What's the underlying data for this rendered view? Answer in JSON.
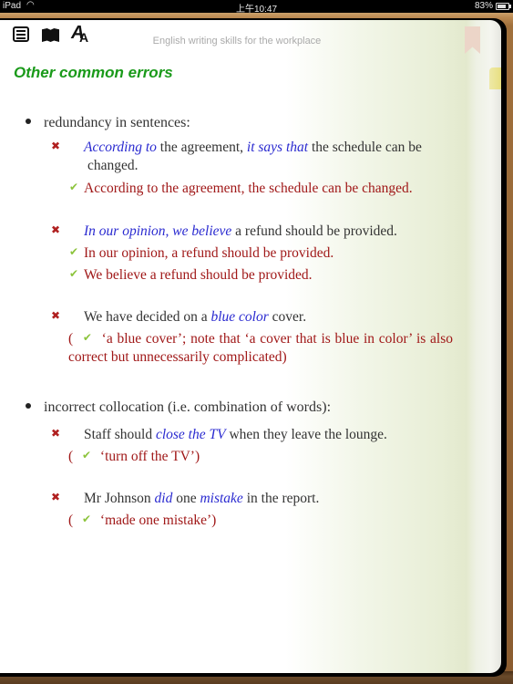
{
  "status_bar": {
    "device": "iPad",
    "wifi_icon": "wifi-icon",
    "time": "上午10:47",
    "battery_percent": "83%",
    "battery_icon": "battery-icon"
  },
  "toolbar": {
    "icons": [
      "table-of-contents-icon",
      "bookmarks-icon",
      "font-size-icon"
    ],
    "font_icon_big": "A",
    "font_icon_small": "A",
    "book_title": "English writing skills for the workplace"
  },
  "page": {
    "section_title": "Other common errors",
    "sections": [
      {
        "heading": "redundancy in sentences:",
        "examples": [
          {
            "wrong": {
              "parts": [
                {
                  "t": "According to",
                  "hl": true
                },
                {
                  "t": " the agreement, "
                },
                {
                  "t": "it says that",
                  "hl": true
                },
                {
                  "t": " the schedule can be changed."
                }
              ]
            },
            "correct": [
              "According to the agreement, the schedule can be changed."
            ]
          },
          {
            "wrong": {
              "parts": [
                {
                  "t": "In our opinion, we believe",
                  "hl": true
                },
                {
                  "t": " a refund should be provided."
                }
              ]
            },
            "correct": [
              "In our opinion, a refund should be provided.",
              "We believe a refund should be provided."
            ]
          },
          {
            "wrong": {
              "parts": [
                {
                  "t": "We have decided on a "
                },
                {
                  "t": "blue color",
                  "hl": true
                },
                {
                  "t": " cover."
                }
              ]
            },
            "note": {
              "open": "(",
              "text": "‘a blue cover’; note that ‘a cover that is blue in color’ is also correct but unnecessarily complicated)"
            }
          }
        ]
      },
      {
        "heading": "incorrect collocation (i.e. combination of words):",
        "examples": [
          {
            "wrong": {
              "parts": [
                {
                  "t": "Staff should "
                },
                {
                  "t": "close the TV",
                  "hl": true
                },
                {
                  "t": " when they leave the lounge."
                }
              ]
            },
            "note": {
              "open": "(",
              "text": "‘turn off the TV’)"
            }
          },
          {
            "wrong": {
              "parts": [
                {
                  "t": "Mr Johnson "
                },
                {
                  "t": "did",
                  "hl": true
                },
                {
                  "t": " one "
                },
                {
                  "t": "mistake",
                  "hl": true
                },
                {
                  "t": " in the report."
                }
              ]
            },
            "note": {
              "open": "(",
              "text": "‘made one mistake’)"
            }
          }
        ]
      }
    ]
  },
  "marks": {
    "wrong": "✖",
    "correct": "✔"
  },
  "progress": {
    "fraction": 0.72
  },
  "colors": {
    "section_title": "#1a9a1a",
    "highlight": "#2a2ad0",
    "correct_text": "#a01818",
    "wrong_mark": "#b02020",
    "check_mark": "#8cc43c",
    "slider_fill": "#3a78d8"
  }
}
